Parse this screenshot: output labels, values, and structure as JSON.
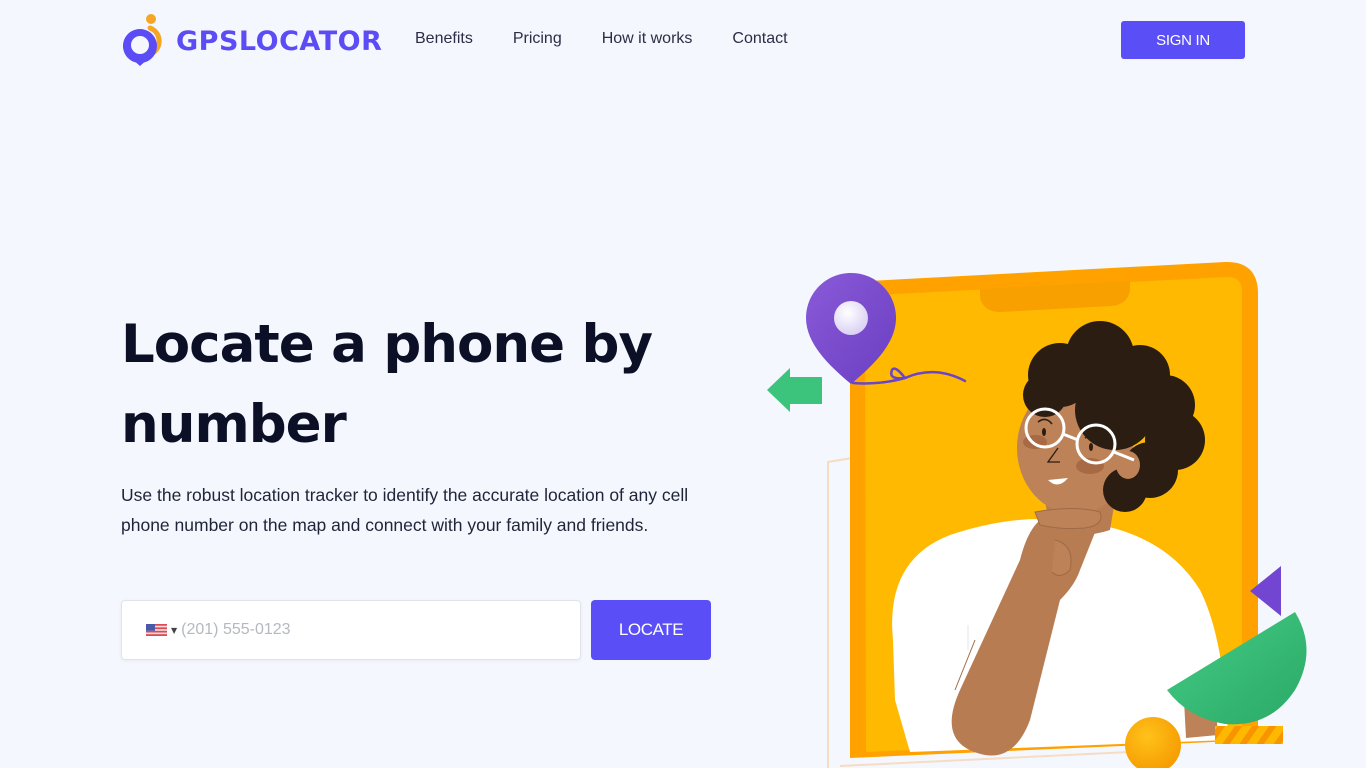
{
  "header": {
    "brand": "GPSLOCATOR",
    "nav": [
      {
        "label": "Benefits"
      },
      {
        "label": "Pricing"
      },
      {
        "label": "How it works"
      },
      {
        "label": "Contact"
      }
    ],
    "signin_label": "SIGN IN"
  },
  "hero": {
    "title": "Locate a phone by number",
    "description": "Use the robust location tracker to identify the accurate location of any cell phone number on the map and connect with your family and friends.",
    "phone_input": {
      "country": "US",
      "flag_icon": "us-flag-icon",
      "value": "",
      "placeholder": "(201) 555-0123"
    },
    "locate_label": "LOCATE"
  },
  "colors": {
    "brand_purple": "#5a4ff6",
    "brand_orange": "#f5a623",
    "background": "#f4f7fd",
    "phone_yellow": "#ffb800",
    "accent_green": "#3ec57e"
  },
  "illustration": {
    "subject": "person-thinking-with-phone-and-location-pin"
  }
}
